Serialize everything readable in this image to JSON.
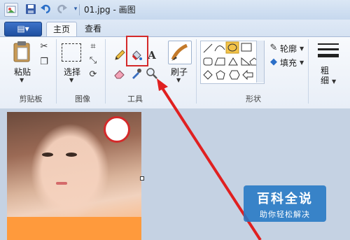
{
  "window": {
    "title": "01.jpg - 画图"
  },
  "tabs": {
    "file_label": "▤▾",
    "home": "主页",
    "view": "查看"
  },
  "clipboard": {
    "paste": "粘贴",
    "group": "剪贴板"
  },
  "image": {
    "select": "选择",
    "group": "图像"
  },
  "tools": {
    "group": "工具"
  },
  "brushes": {
    "label": "刷子"
  },
  "shapes": {
    "outline": "轮廓",
    "fill": "填充",
    "group": "形状"
  },
  "size": {
    "label": "粗细"
  },
  "watermark": {
    "title": "百科全说",
    "subtitle": "助你轻松解决"
  },
  "colors": {
    "highlight_red": "#d42a2a",
    "arrow_red": "#e02020",
    "selected_shape": "#f3c34a"
  }
}
